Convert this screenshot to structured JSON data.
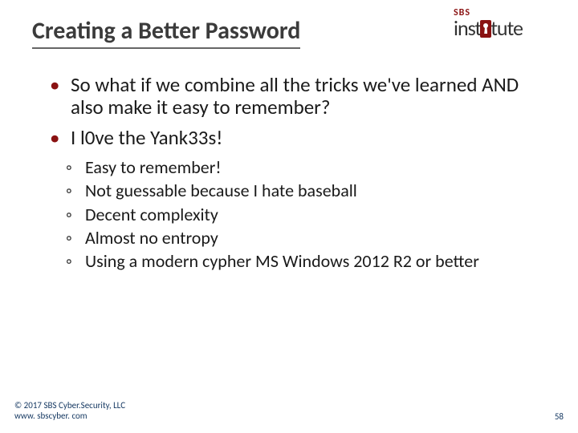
{
  "logo": {
    "top": "SBS",
    "bottom_pre": "inst",
    "bottom_post": "tute"
  },
  "title": "Creating a Better Password",
  "bullets": [
    "So what if we combine all the tricks we've learned AND also make it easy to remember?",
    "I l0ve the Yank33s!"
  ],
  "sub_bullets": [
    "Easy to remember!",
    "Not guessable because I hate baseball",
    "Decent complexity",
    "Almost no entropy",
    "Using a modern cypher MS Windows 2012 R2 or better"
  ],
  "footer": {
    "line1": "© 2017 SBS Cyber.Security, LLC",
    "line2": "www. sbscyber. com",
    "page": "58"
  }
}
